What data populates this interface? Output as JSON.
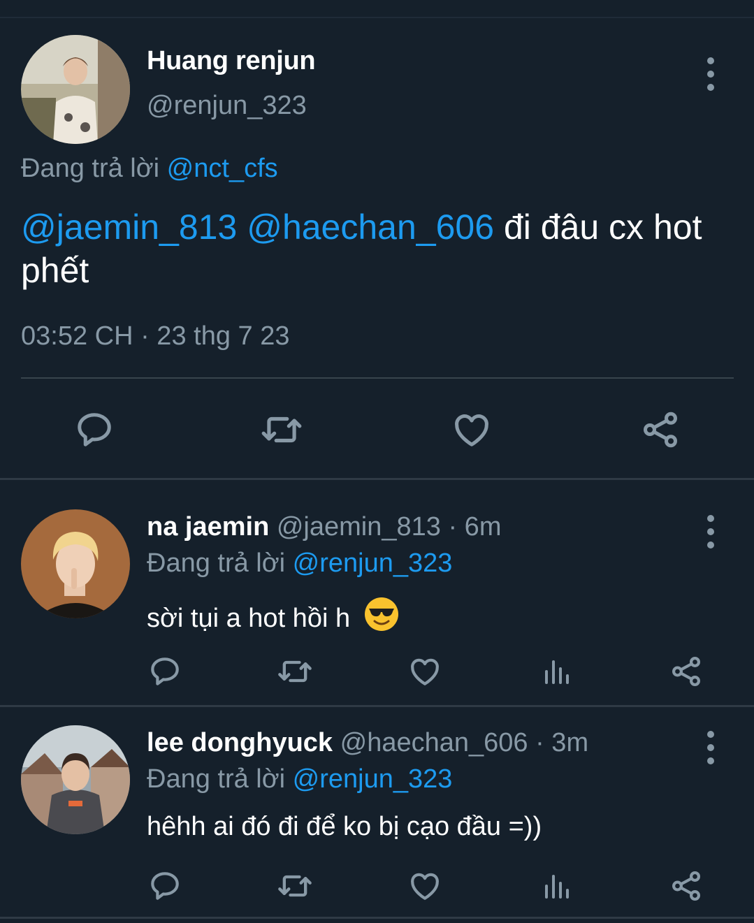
{
  "main_tweet": {
    "author_name": "Huang renjun",
    "author_handle": "@renjun_323",
    "replying_label": "Đang trả lời",
    "replying_to": "@nct_cfs",
    "mention_1": "@jaemin_813",
    "mention_2": "@haechan_606",
    "text_line1": "đi đâu cx hot",
    "text_line2": "phết",
    "timestamp": "03:52 CH · 23 thg 7 23"
  },
  "replies": [
    {
      "author_name": "na jaemin",
      "meta": "@jaemin_813 · 6m",
      "replying_label": "Đang trả lời",
      "replying_to": "@renjun_323",
      "text": "sời tụi a hot hồi h",
      "emoji": "smiling-face-with-sunglasses"
    },
    {
      "author_name": "lee donghyuck",
      "meta": "@haechan_606 · 3m",
      "replying_label": "Đang trả lời",
      "replying_to": "@renjun_323",
      "text": "hêhh ai đó đi để ko bị cạo đầu =))"
    }
  ],
  "colors": {
    "background": "#15202b",
    "link": "#1d9bf0",
    "secondary_text": "#8899a6",
    "divider": "#38444d"
  },
  "icons": [
    "reply-icon",
    "retweet-icon",
    "like-icon",
    "analytics-icon",
    "share-icon",
    "more-options-icon"
  ]
}
